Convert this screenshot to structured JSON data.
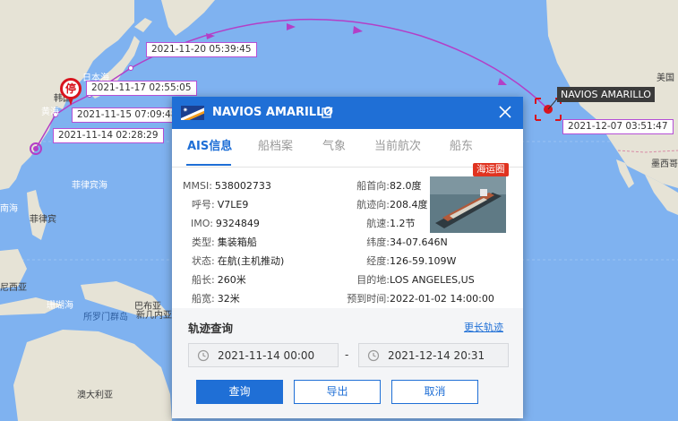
{
  "map": {
    "labels": {
      "korea": "韩国",
      "japan": "日本",
      "japan_sea": "日本海",
      "yellow_sea": "黄海",
      "philippine_sea": "菲律宾海",
      "south_sea": "南海",
      "philippines": "菲律宾",
      "indonesia": "尼西亚",
      "papua": "巴布亚",
      "new_guinea": "新几内亚",
      "solomon": "所罗门群岛",
      "coral_sea": "珊瑚海",
      "australia": "澳大利亚",
      "usa": "美国",
      "mexico": "墨西哥"
    },
    "track_points": [
      {
        "time": "2021-11-14 02:28:29"
      },
      {
        "time": "2021-11-15 07:09:48"
      },
      {
        "time": "2021-11-17 02:55:05"
      },
      {
        "time": "2021-11-20 05:39:45"
      },
      {
        "time": "2021-12-07 03:51:47"
      }
    ],
    "ship_tag": "NAVIOS AMARILLO",
    "stop_marker": "停",
    "colors": {
      "ocean": "#7fb2f0",
      "land": "#e6e3d6",
      "track": "#b33fc7",
      "stop": "#d8141e"
    }
  },
  "panel": {
    "title": "NAVIOS AMARILLO",
    "flag": "marshall-islands-flag",
    "tabs": [
      "AIS信息",
      "船档案",
      "气象",
      "当前航次",
      "船东"
    ],
    "badge": "海运圈",
    "left_fields": [
      {
        "label": "MMSI:",
        "value": "538002733"
      },
      {
        "label": "呼号:",
        "value": "V7LE9"
      },
      {
        "label": "IMO:",
        "value": "9324849"
      },
      {
        "label": "类型:",
        "value": "集装箱船"
      },
      {
        "label": "状态:",
        "value": "在航(主机推动)"
      },
      {
        "label": "船长:",
        "value": "260米"
      },
      {
        "label": "船宽:",
        "value": "32米"
      }
    ],
    "right_fields": [
      {
        "label": "船首向:",
        "value": "82.0度"
      },
      {
        "label": "航迹向:",
        "value": "208.4度"
      },
      {
        "label": "航速:",
        "value": "1.2节"
      },
      {
        "label": "纬度:",
        "value": "34-07.646N"
      },
      {
        "label": "经度:",
        "value": "126-59.109W"
      },
      {
        "label": "目的地:",
        "value": "LOS ANGELES,US"
      },
      {
        "label": "预到时间:",
        "value": "2022-01-02 14:00:00"
      }
    ],
    "track": {
      "title": "轨迹查询",
      "longer_link": "更长轨迹",
      "start": "2021-11-14 00:00",
      "separator": "-",
      "end": "2021-12-14 20:31",
      "query": "查询",
      "export": "导出",
      "cancel": "取消"
    },
    "colors": {
      "accent": "#1f6fd6",
      "badge": "#e03320"
    }
  }
}
